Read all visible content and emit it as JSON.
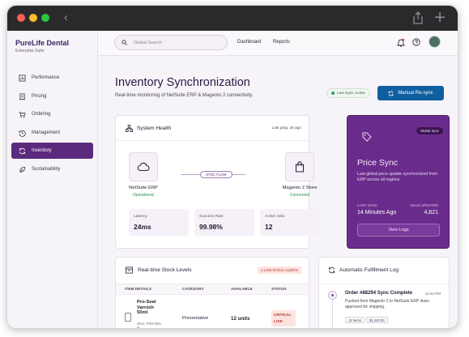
{
  "app": {
    "brand": "PureLife Dental",
    "brand_sub": "Enterprise Suite"
  },
  "sidebar": {
    "items": [
      {
        "label": "Performance",
        "icon": "chart-icon"
      },
      {
        "label": "Pricing",
        "icon": "receipt-icon"
      },
      {
        "label": "Ordering",
        "icon": "cart-icon"
      },
      {
        "label": "Management",
        "icon": "history-icon"
      },
      {
        "label": "Inventory",
        "icon": "sync-icon",
        "active": true
      },
      {
        "label": "Sustainability",
        "icon": "leaf-icon"
      }
    ]
  },
  "topbar": {
    "search_placeholder": "Global Search",
    "links": [
      "Dashboard",
      "Reports"
    ]
  },
  "header": {
    "title": "Inventory Synchronization",
    "subtitle": "Real-time monitoring of NetSuite ERP & Magento 2 connectivity.",
    "live_status": "Live Sync Active",
    "resync_button": "Manual Re-sync"
  },
  "health": {
    "title": "System Health",
    "last_ping": "Last ping: 2s ago",
    "left_system": {
      "name": "NetSuite ERP",
      "status": "Operational"
    },
    "right_system": {
      "name": "Magento 2 Store",
      "status": "Connected"
    },
    "flow_label": "SYNC FLOW",
    "metrics": [
      {
        "label": "Latency",
        "value": "24ms"
      },
      {
        "label": "Success Rate",
        "value": "99.98%"
      },
      {
        "label": "Active Jobs",
        "value": "12"
      }
    ]
  },
  "price_sync": {
    "badge": "Global Sync",
    "title": "Price Sync",
    "description": "Last global price update synchronized from ERP across all regions.",
    "last_sync_label": "LAST SYNC",
    "last_sync_value": "14 Minutes Ago",
    "skus_label": "SKUS UPDATED",
    "skus_value": "4,821",
    "button": "View Logs"
  },
  "stock": {
    "title": "Real-time Stock Levels",
    "badge": "4 LOW STOCK ALERTS",
    "columns": [
      "ITEM DETAILS",
      "CATEGORY",
      "AVAILABLE",
      "STATUS"
    ],
    "rows": [
      {
        "name": "Pro-Seal Varnish 50ml",
        "sku": "SKU: PSV-001-B",
        "category": "Preventative",
        "available": "12 units",
        "status": "CRITICAL LOW"
      }
    ]
  },
  "fulfillment": {
    "title": "Automatic Fulfillment Log",
    "events": [
      {
        "title": "Order #88294 Sync Complete",
        "time": "12:42 PM",
        "description": "Pushed from Magento 2 to NetSuite ERP. Auto-approved for shipping.",
        "chips": [
          "12 items",
          "$1,240.00"
        ]
      }
    ]
  },
  "colors": {
    "accent": "#5b2a7d",
    "primary_button": "#0f5fa0",
    "critical": "#b3362a",
    "success": "#2d8a4a"
  }
}
